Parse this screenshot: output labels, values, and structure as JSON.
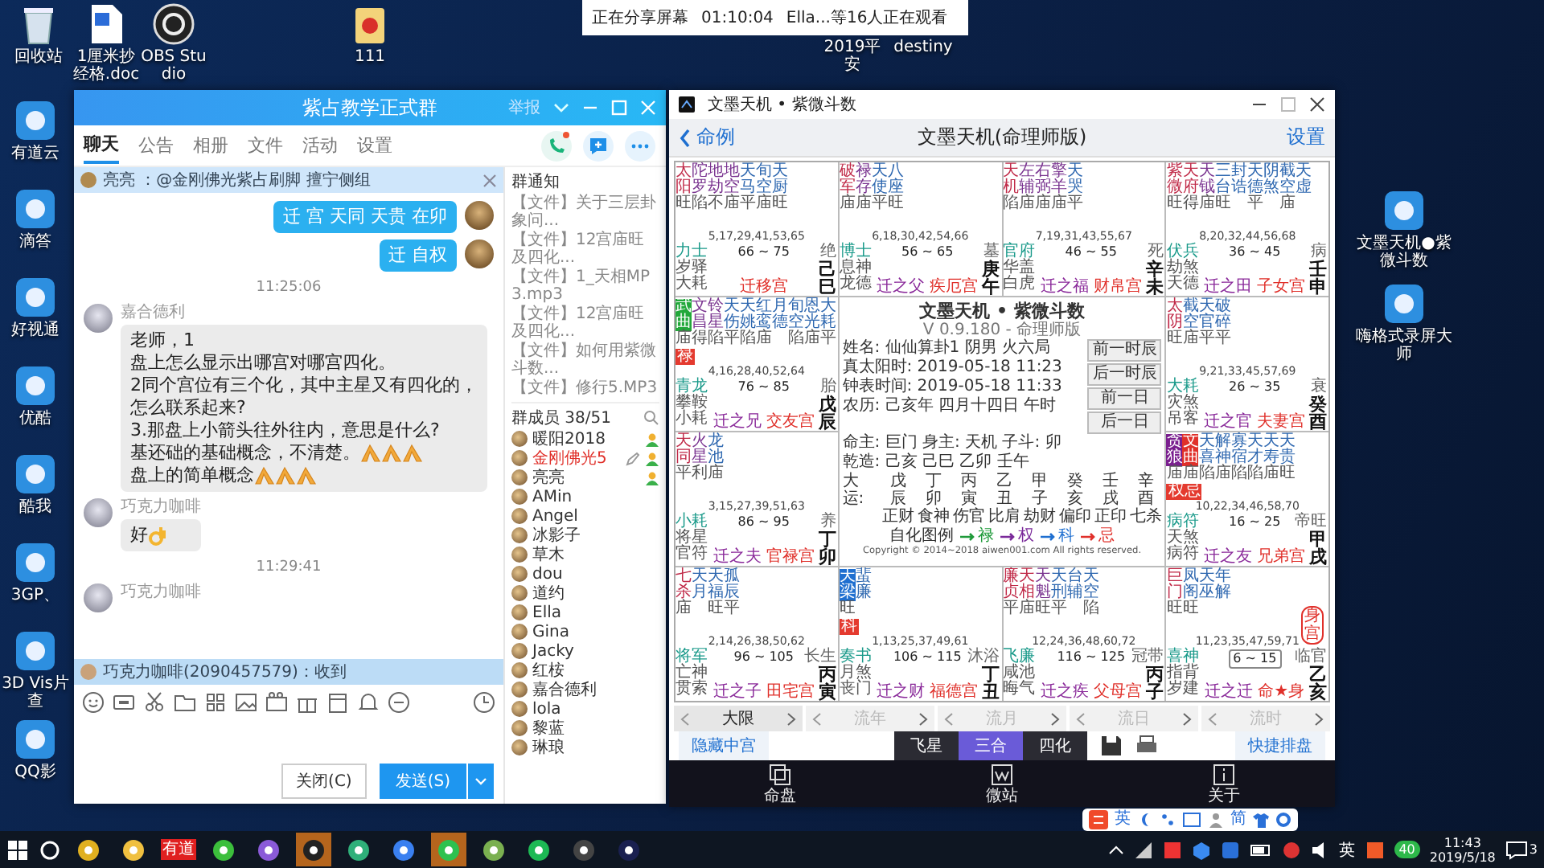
{
  "share_bar": {
    "status": "正在分享屏幕",
    "elapsed": "01:10:04",
    "viewers": "Ella...等16人正在观看"
  },
  "desktop_top": [
    {
      "label": "回收站",
      "kind": "recycle"
    },
    {
      "label": "1厘米抄经格.doc",
      "kind": "doc"
    },
    {
      "label": "OBS Studio",
      "kind": "obs"
    },
    {
      "label": "111",
      "kind": "folder"
    },
    {
      "label": "2019平安",
      "kind": "covered"
    },
    {
      "label": "destiny",
      "kind": "covered"
    }
  ],
  "desktop_left": [
    {
      "label": "有道云",
      "kind": "app"
    },
    {
      "label": "滴答",
      "kind": "app"
    },
    {
      "label": "好视通",
      "kind": "app"
    },
    {
      "label": "优酷",
      "kind": "app"
    },
    {
      "label": "酷我",
      "kind": "app"
    },
    {
      "label": "3GP、",
      "kind": "app"
    },
    {
      "label": "3D Vis片查",
      "kind": "app"
    },
    {
      "label": "QQ影",
      "kind": "app"
    }
  ],
  "desktop_right": [
    {
      "label": "文墨天机●紫微斗数",
      "kind": "app"
    },
    {
      "label": "嗨格式录屏大师",
      "kind": "app"
    }
  ],
  "chat_window": {
    "title": "紫占教学正式群",
    "report": "举报",
    "tabs": [
      {
        "label": "聊天",
        "selected": true
      },
      {
        "label": "公告",
        "selected": false
      },
      {
        "label": "相册",
        "selected": false
      },
      {
        "label": "文件",
        "selected": false
      },
      {
        "label": "活动",
        "selected": false
      },
      {
        "label": "设置",
        "selected": false
      }
    ],
    "pinned": "亮亮 ：@金刚佛光紫占刷脚 擅宁侧组",
    "messages": [
      {
        "kind": "outgoing",
        "lines": [
          [
            {
              "kind": "text",
              "text": "迁 宫  天同 天贵  在卯"
            }
          ]
        ]
      },
      {
        "kind": "outgoing",
        "lines": [
          [
            {
              "kind": "text",
              "text": "迁 自权"
            }
          ]
        ]
      },
      {
        "kind": "time",
        "text": "11:25:06"
      },
      {
        "kind": "incoming",
        "sender": "嘉合德利",
        "lines": [
          [
            {
              "kind": "text",
              "text": "老师，1"
            }
          ],
          [
            {
              "kind": "text",
              "text": "盘上怎么显示出哪宫对哪宫四化。"
            }
          ],
          [
            {
              "kind": "text",
              "text": "2同个宫位有三个化，其中主星又有四化的，怎么联系起来?"
            }
          ],
          [
            {
              "kind": "text",
              "text": "3.那盘上小箭头往外往内，意思是什么?"
            }
          ],
          [
            {
              "kind": "text",
              "text": "基还础的基础概念，不清楚。"
            },
            {
              "kind": "fold"
            },
            {
              "kind": "fold"
            },
            {
              "kind": "fold"
            },
            {
              "kind": "text",
              "text": "盘上的简单概念"
            },
            {
              "kind": "fold"
            },
            {
              "kind": "fold"
            },
            {
              "kind": "fold"
            }
          ]
        ]
      },
      {
        "kind": "incoming",
        "sender": "巧克力咖啡",
        "lines": [
          [
            {
              "kind": "text",
              "text": "好"
            },
            {
              "kind": "ok"
            }
          ]
        ]
      },
      {
        "kind": "time",
        "text": "11:29:41"
      },
      {
        "kind": "incoming",
        "sender": "巧克力咖啡"
      }
    ],
    "notification": "巧克力咖啡(2090457579)：收到",
    "close_button": "关闭(C)",
    "send_button": "发送(S)",
    "notices_title": "群通知",
    "notices": [
      "【文件】关于三层卦象问...",
      "【文件】12宫庙旺及四化...",
      "【文件】1_天相MP3.mp3",
      "【文件】12宫庙旺及四化...",
      "【文件】如何用紫微斗数...",
      "【文件】修行5.MP3"
    ],
    "members_title": "群成员 38/51",
    "members": [
      {
        "name": "暖阳2018",
        "kind": "admin"
      },
      {
        "name": "金刚佛光5",
        "kind": "owner"
      },
      {
        "name": "亮亮",
        "kind": "admin"
      },
      {
        "name": "AMin",
        "kind": "member"
      },
      {
        "name": "Angel",
        "kind": "member"
      },
      {
        "name": "冰影子",
        "kind": "member"
      },
      {
        "name": "草木",
        "kind": "member"
      },
      {
        "name": "dou",
        "kind": "member"
      },
      {
        "name": "道约",
        "kind": "member"
      },
      {
        "name": "Ella",
        "kind": "member"
      },
      {
        "name": "Gina",
        "kind": "member"
      },
      {
        "name": "Jacky",
        "kind": "member"
      },
      {
        "name": "红桉",
        "kind": "member"
      },
      {
        "name": "嘉合德利",
        "kind": "member"
      },
      {
        "name": "lola",
        "kind": "member"
      },
      {
        "name": "黎蓝",
        "kind": "member"
      },
      {
        "name": "琳琅",
        "kind": "member"
      }
    ]
  },
  "astro_window": {
    "title": "文墨天机 • 紫微斗数",
    "back": "命例",
    "heading": "文墨天机(命理师版)",
    "settings": "设置",
    "palaces": [
      {
        "stars": [
          {
            "name": "太阳",
            "bright": "旺",
            "kind": "major"
          },
          {
            "name": "陀罗",
            "bright": "陷",
            "kind": "aux"
          },
          {
            "name": "地劫",
            "bright": "不",
            "kind": "aux"
          },
          {
            "name": "地空",
            "bright": "庙",
            "kind": "aux"
          },
          {
            "name": "天马",
            "bright": "平",
            "kind": "minor"
          },
          {
            "name": "旬空",
            "bright": "庙",
            "kind": "minor"
          },
          {
            "name": "天厨",
            "bright": "旺",
            "kind": "minor"
          }
        ],
        "ages": "5,17,29,41,53,65",
        "labels": [
          "力士",
          "岁驿",
          "大耗"
        ],
        "range": "66 ~ 75",
        "name": "迁移宫",
        "corner": "绝",
        "stem": "己巳",
        "current": false
      },
      {
        "stars": [
          {
            "name": "破军",
            "bright": "庙",
            "kind": "major"
          },
          {
            "name": "禄存",
            "bright": "庙",
            "kind": "aux"
          },
          {
            "name": "天使",
            "bright": "平",
            "kind": "minor"
          },
          {
            "name": "八座",
            "bright": "旺",
            "kind": "minor"
          }
        ],
        "ages": "6,18,30,42,54,66",
        "labels": [
          "博士",
          "息神",
          "龙德"
        ],
        "relation": "迁之父",
        "range": "56 ~ 65",
        "name": "疾厄宫",
        "corner": "墓",
        "stem": "庚午",
        "current": false
      },
      {
        "stars": [
          {
            "name": "天机",
            "bright": "陷",
            "kind": "major"
          },
          {
            "name": "左辅",
            "bright": "庙",
            "kind": "aux"
          },
          {
            "name": "右弼",
            "bright": "庙",
            "kind": "aux"
          },
          {
            "name": "擎羊",
            "bright": "庙",
            "kind": "aux"
          },
          {
            "name": "天哭",
            "bright": "平",
            "kind": "minor"
          }
        ],
        "ages": "7,19,31,43,55,67",
        "labels": [
          "官府",
          "华盖",
          "白虎"
        ],
        "relation": "迁之福",
        "range": "46 ~ 55",
        "name": "财帛宫",
        "corner": "死",
        "stem": "辛未",
        "current": false
      },
      {
        "stars": [
          {
            "name": "紫微",
            "bright": "旺",
            "kind": "major"
          },
          {
            "name": "天府",
            "bright": "得",
            "kind": "major"
          },
          {
            "name": "天钺",
            "bright": "庙",
            "kind": "aux"
          },
          {
            "name": "三台",
            "bright": "旺",
            "kind": "minor"
          },
          {
            "name": "封诰",
            "kind": "minor"
          },
          {
            "name": "天德",
            "bright": "平",
            "kind": "minor"
          },
          {
            "name": "阴煞",
            "kind": "minor"
          },
          {
            "name": "截空",
            "bright": "庙",
            "kind": "minor"
          },
          {
            "name": "天虚",
            "kind": "minor"
          }
        ],
        "ages": "8,20,32,44,56,68",
        "labels": [
          "伏兵",
          "劫煞",
          "天德"
        ],
        "relation": "迁之田",
        "range": "36 ~ 45",
        "name": "子女宫",
        "corner": "病",
        "stem": "壬申",
        "current": false
      },
      {
        "stars": [
          {
            "name": "武曲",
            "bright": "庙",
            "kind": "major",
            "color": "#22a83a"
          },
          {
            "name": "文昌",
            "bright": "得",
            "kind": "aux"
          },
          {
            "name": "铃星",
            "bright": "陷",
            "kind": "aux"
          },
          {
            "name": "天伤",
            "bright": "平",
            "kind": "minor"
          },
          {
            "name": "天姚",
            "bright": "陷",
            "kind": "minor"
          },
          {
            "name": "红鸾",
            "bright": "庙",
            "kind": "minor"
          },
          {
            "name": "月德",
            "kind": "minor"
          },
          {
            "name": "旬空",
            "bright": "陷",
            "kind": "minor"
          },
          {
            "name": "恩光",
            "bright": "庙",
            "kind": "minor"
          },
          {
            "name": "大耗",
            "bright": "平",
            "kind": "minor"
          }
        ],
        "badge": "禄",
        "ages": "4,16,28,40,52,64",
        "labels": [
          "青龙",
          "攀鞍",
          "小耗"
        ],
        "relation": "迁之兄",
        "range": "76 ~ 85",
        "name": "交友宫",
        "corner": "胎",
        "stem": "戊辰",
        "current": false
      },
      {
        "stars": [
          {
            "name": "太阴",
            "bright": "旺",
            "kind": "major"
          },
          {
            "name": "截空",
            "bright": "庙",
            "kind": "minor"
          },
          {
            "name": "天官",
            "bright": "平",
            "kind": "minor"
          },
          {
            "name": "破碎",
            "bright": "平",
            "kind": "minor"
          }
        ],
        "ages": "9,21,33,45,57,69",
        "labels": [
          "大耗",
          "灾煞",
          "吊客"
        ],
        "relation": "迁之官",
        "range": "26 ~ 35",
        "name": "夫妻宫",
        "corner": "衰",
        "stem": "癸酉",
        "current": false
      },
      {
        "stars": [
          {
            "name": "天同",
            "bright": "平",
            "kind": "major"
          },
          {
            "name": "火星",
            "bright": "利",
            "kind": "aux"
          },
          {
            "name": "龙池",
            "bright": "庙",
            "kind": "minor"
          }
        ],
        "ages": "3,15,27,39,51,63",
        "labels": [
          "小耗",
          "将星",
          "官符"
        ],
        "relation": "迁之夫",
        "range": "86 ~ 95",
        "name": "官禄宫",
        "corner": "养",
        "stem": "丁卯",
        "current": false
      },
      {
        "stars": [
          {
            "name": "贪狼",
            "bright": "庙",
            "kind": "major",
            "color": "#7a1f8f"
          },
          {
            "name": "文曲",
            "bright": "庙",
            "kind": "aux",
            "color": "#e0302a"
          },
          {
            "name": "天喜",
            "bright": "陷",
            "kind": "minor"
          },
          {
            "name": "解神",
            "bright": "庙",
            "kind": "minor"
          },
          {
            "name": "寡宿",
            "bright": "陷",
            "kind": "minor"
          },
          {
            "name": "天才",
            "bright": "陷",
            "kind": "minor"
          },
          {
            "name": "天寿",
            "bright": "庙",
            "kind": "minor"
          },
          {
            "name": "天贵",
            "bright": "旺",
            "kind": "minor"
          }
        ],
        "badge": "权忌",
        "ages": "10,22,34,46,58,70",
        "labels": [
          "病符",
          "天煞",
          "病符"
        ],
        "relation": "迁之友",
        "range": "16 ~ 25",
        "name": "兄弟宫",
        "corner": "帝旺",
        "stem": "甲戌",
        "current": false
      },
      {
        "stars": [
          {
            "name": "七杀",
            "bright": "庙",
            "kind": "major"
          },
          {
            "name": "天月",
            "kind": "minor"
          },
          {
            "name": "天福",
            "bright": "旺",
            "kind": "minor"
          },
          {
            "name": "孤辰",
            "bright": "平",
            "kind": "minor"
          }
        ],
        "ages": "2,14,26,38,50,62",
        "labels": [
          "将军",
          "亡神",
          "贯索"
        ],
        "relation": "迁之子",
        "range": "96 ~ 105",
        "name": "田宅宫",
        "corner": "长生",
        "stem": "丙寅",
        "current": false
      },
      {
        "stars": [
          {
            "name": "天梁",
            "bright": "旺",
            "kind": "major",
            "color": "#1f6fd0"
          },
          {
            "name": "蜚廉",
            "kind": "minor"
          }
        ],
        "badge": "科",
        "ages": "1,13,25,37,49,61",
        "labels": [
          "奏书",
          "月煞",
          "丧门"
        ],
        "relation": "迁之财",
        "range": "106 ~ 115",
        "name": "福德宫",
        "corner": "沐浴",
        "stem": "丁丑",
        "current": false
      },
      {
        "stars": [
          {
            "name": "廉贞",
            "bright": "平",
            "kind": "major"
          },
          {
            "name": "天相",
            "bright": "庙",
            "kind": "major"
          },
          {
            "name": "天魁",
            "bright": "旺",
            "kind": "aux"
          },
          {
            "name": "天刑",
            "bright": "平",
            "kind": "minor"
          },
          {
            "name": "台辅",
            "kind": "minor"
          },
          {
            "name": "天空",
            "bright": "陷",
            "kind": "minor"
          }
        ],
        "ages": "12,24,36,48,60,72",
        "labels": [
          "飞廉",
          "咸池",
          "晦气"
        ],
        "relation": "迁之疾",
        "range": "116 ~ 125",
        "name": "父母宫",
        "corner": "冠带",
        "stem": "丙子",
        "current": false
      },
      {
        "stars": [
          {
            "name": "巨门",
            "bright": "旺",
            "kind": "major"
          },
          {
            "name": "凤阁",
            "bright": "旺",
            "kind": "minor"
          },
          {
            "name": "天巫",
            "kind": "minor"
          },
          {
            "name": "年解",
            "kind": "minor"
          }
        ],
        "body_badge": "身宫",
        "ages": "11,23,35,47,59,71",
        "labels": [
          "喜神",
          "指背",
          "岁建"
        ],
        "relation": "迁之迁",
        "range": "6 ~ 15",
        "name": "命★身",
        "corner": "临官",
        "stem": "乙亥",
        "current": true
      }
    ],
    "center": {
      "title": "文墨天机 • 紫微斗数",
      "version": "V 0.9.180 - 命理师版",
      "info": [
        "姓名: 仙仙算卦1  阴男 火六局",
        "真太阳时: 2019-05-18 11:23",
        "钟表时间: 2019-05-18 11:33",
        "农历: 己亥年 四月十四日 午时"
      ],
      "buttons": [
        "前一时辰",
        "后一时辰",
        "前一日",
        "后一日"
      ],
      "lines": [
        "命主: 巨门 身主: 天机 子斗: 卯",
        "乾造: 己亥   己巳   乙卯   壬午"
      ],
      "dayun_label": "大运:",
      "dayun": [
        [
          "戊",
          "辰",
          "正财"
        ],
        [
          "丁",
          "卯",
          "食神"
        ],
        [
          "丙",
          "寅",
          "伤官"
        ],
        [
          "乙",
          "丑",
          "比肩"
        ],
        [
          "甲",
          "子",
          "劫财"
        ],
        [
          "癸",
          "亥",
          "偏印"
        ],
        [
          "壬",
          "戌",
          "正印"
        ],
        [
          "辛",
          "酉",
          "七杀"
        ]
      ],
      "legend_label": "自化图例",
      "legend": [
        {
          "label": "禄",
          "color": "#1f9a3a"
        },
        {
          "label": "权",
          "color": "#7a2a9a"
        },
        {
          "label": "科",
          "color": "#1f6fd0"
        },
        {
          "label": "忌",
          "color": "#e0302a"
        }
      ],
      "copyright": "Copyright © 2014~2018 aiwen001.com All rights reserved."
    },
    "steppers": [
      {
        "label": "大限",
        "enabled": true
      },
      {
        "label": "流年",
        "enabled": false
      },
      {
        "label": "流月",
        "enabled": false
      },
      {
        "label": "流日",
        "enabled": false
      },
      {
        "label": "流时",
        "enabled": false
      }
    ],
    "hide_center": "隐藏中宫",
    "modes": [
      {
        "label": "飞星",
        "selected": false
      },
      {
        "label": "三合",
        "selected": true
      },
      {
        "label": "四化",
        "selected": false
      }
    ],
    "quick": "快捷排盘",
    "nav": [
      {
        "label": "命盘",
        "kind": "chart"
      },
      {
        "label": "微站",
        "kind": "site"
      },
      {
        "label": "关于",
        "kind": "about"
      }
    ]
  },
  "ime_bar": {
    "mode": "英",
    "script": "简"
  },
  "taskbar": {
    "apps": [
      {
        "kind": "chrome",
        "highlighted": false
      },
      {
        "kind": "explorer",
        "highlighted": false
      },
      {
        "kind": "youdao",
        "label": "有道",
        "highlighted": false
      },
      {
        "kind": "green",
        "highlighted": false
      },
      {
        "kind": "vs",
        "highlighted": false
      },
      {
        "kind": "qq",
        "highlighted": true
      },
      {
        "kind": "cloud",
        "highlighted": false
      },
      {
        "kind": "tick",
        "highlighted": false
      },
      {
        "kind": "wechat",
        "highlighted": true
      },
      {
        "kind": "paint",
        "highlighted": false
      },
      {
        "kind": "music",
        "highlighted": false
      },
      {
        "kind": "obs",
        "highlighted": false
      },
      {
        "kind": "galaxy",
        "highlighted": false
      }
    ],
    "ime": "英",
    "time": "11:43",
    "date": "2019/5/18",
    "badge": "40",
    "notifications": "3"
  }
}
